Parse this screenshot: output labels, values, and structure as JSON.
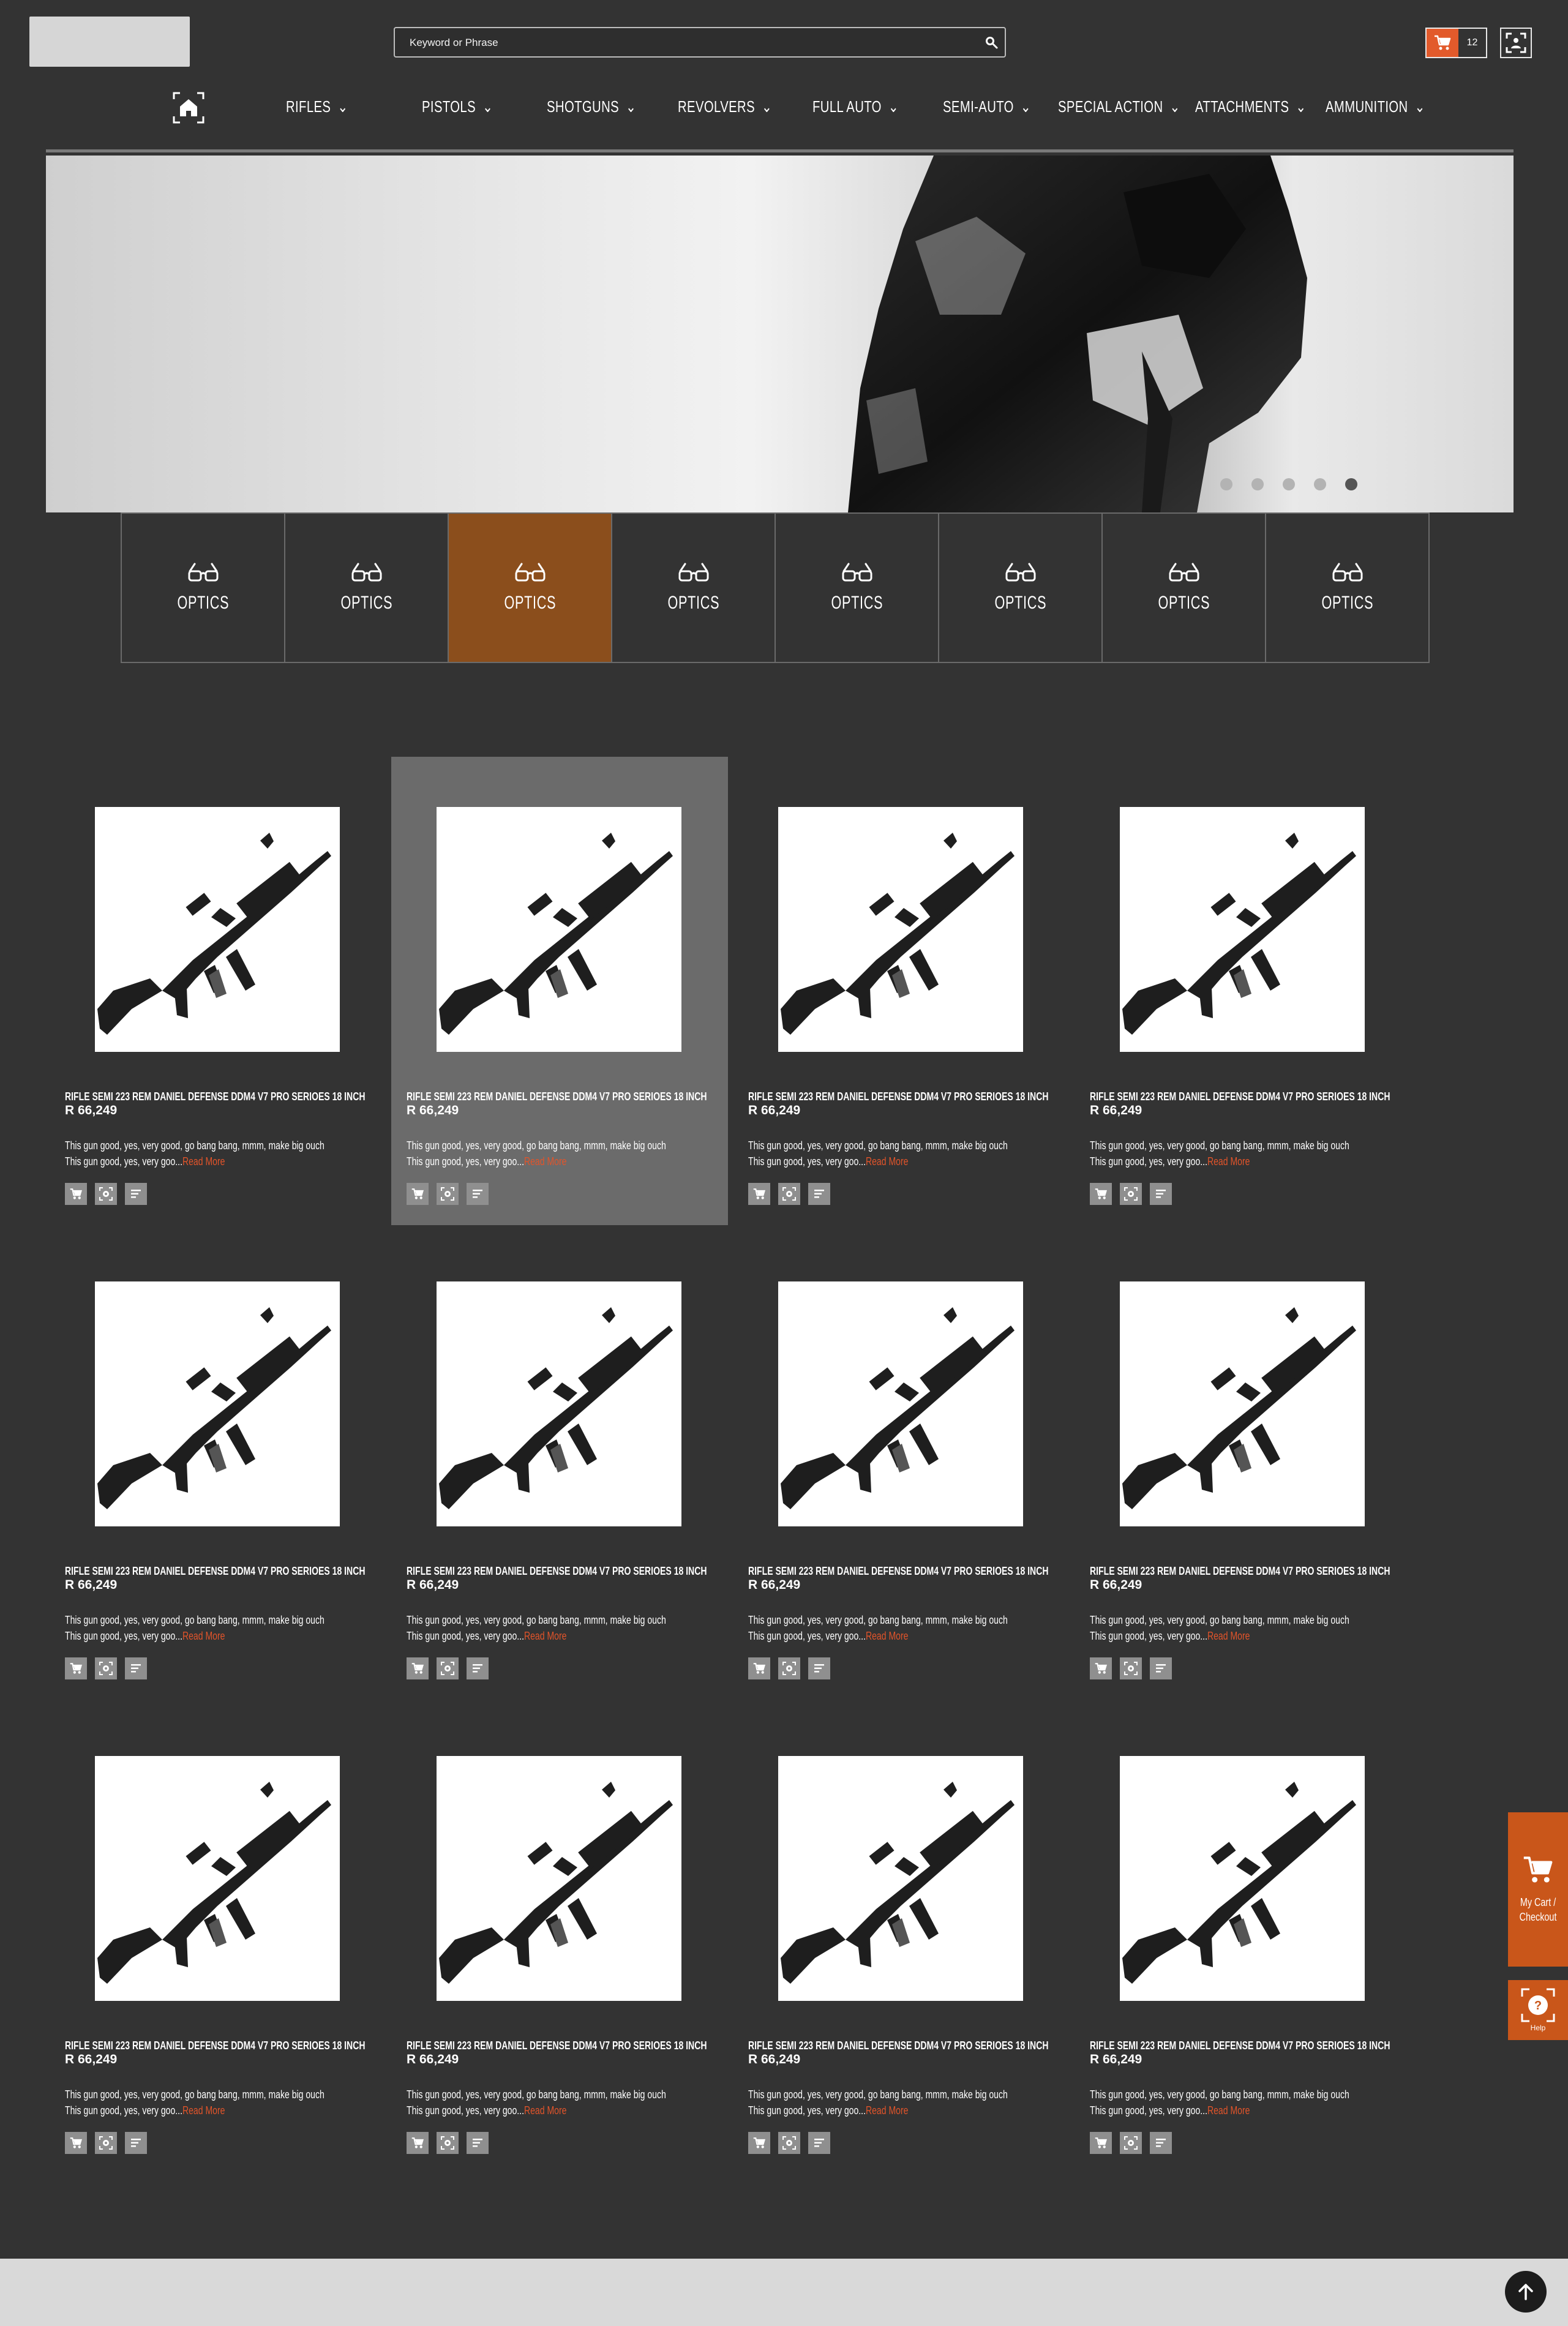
{
  "search": {
    "placeholder": "Keyword or Phrase"
  },
  "header": {
    "cart_count": "12"
  },
  "nav": {
    "items": [
      {
        "label": "RIFLES"
      },
      {
        "label": "PISTOLS"
      },
      {
        "label": "SHOTGUNS"
      },
      {
        "label": "REVOLVERS"
      },
      {
        "label": "FULL AUTO"
      },
      {
        "label": "SEMI-AUTO"
      },
      {
        "label": "SPECIAL ACTION"
      },
      {
        "label": "ATTACHMENTS"
      },
      {
        "label": "AMMUNITION"
      }
    ]
  },
  "slider": {
    "dot_count": 5,
    "active_dot": 5
  },
  "categories": [
    {
      "label": "OPTICS",
      "icon": "glasses-icon"
    },
    {
      "label": "OPTICS",
      "icon": "glasses-icon"
    },
    {
      "label": "OPTICS",
      "icon": "glasses-icon",
      "active": true
    },
    {
      "label": "OPTICS",
      "icon": "glasses-icon"
    },
    {
      "label": "OPTICS",
      "icon": "glasses-icon"
    },
    {
      "label": "OPTICS",
      "icon": "glasses-icon"
    },
    {
      "label": "OPTICS",
      "icon": "glasses-icon"
    },
    {
      "label": "OPTICS",
      "icon": "glasses-icon"
    }
  ],
  "products": [
    {
      "title": "RIFLE SEMI 223 REM DANIEL DEFENSE DDM4 V7 PRO SERIOES 18 INCH",
      "price": "R 66,249",
      "desc_line1": "This gun good, yes, very good, go bang bang, mmm, make big ouch",
      "desc_line2": "This gun good, yes, very goo...",
      "read_more": "Read More"
    },
    {
      "title": "RIFLE SEMI 223 REM DANIEL DEFENSE DDM4 V7 PRO SERIOES 18 INCH",
      "price": "R 66,249",
      "desc_line1": "This gun good, yes, very good, go bang bang, mmm, make big ouch",
      "desc_line2": "This gun good, yes, very goo...",
      "read_more": "Read More"
    },
    {
      "title": "RIFLE SEMI 223 REM DANIEL DEFENSE DDM4 V7 PRO SERIOES 18 INCH",
      "price": "R 66,249",
      "desc_line1": "This gun good, yes, very good, go bang bang, mmm, make big ouch",
      "desc_line2": "This gun good, yes, very goo...",
      "read_more": "Read More"
    },
    {
      "title": "RIFLE SEMI 223 REM DANIEL DEFENSE DDM4 V7 PRO SERIOES 18 INCH",
      "price": "R 66,249",
      "desc_line1": "This gun good, yes, very good, go bang bang, mmm, make big ouch",
      "desc_line2": "This gun good, yes, very goo...",
      "read_more": "Read More"
    },
    {
      "title": "RIFLE SEMI 223 REM DANIEL DEFENSE DDM4 V7 PRO SERIOES 18 INCH",
      "price": "R 66,249",
      "desc_line1": "This gun good, yes, very good, go bang bang, mmm, make big ouch",
      "desc_line2": "This gun good, yes, very goo...",
      "read_more": "Read More"
    },
    {
      "title": "RIFLE SEMI 223 REM DANIEL DEFENSE DDM4 V7 PRO SERIOES 18 INCH",
      "price": "R 66,249",
      "desc_line1": "This gun good, yes, very good, go bang bang, mmm, make big ouch",
      "desc_line2": "This gun good, yes, very goo...",
      "read_more": "Read More"
    },
    {
      "title": "RIFLE SEMI 223 REM DANIEL DEFENSE DDM4 V7 PRO SERIOES 18 INCH",
      "price": "R 66,249",
      "desc_line1": "This gun good, yes, very good, go bang bang, mmm, make big ouch",
      "desc_line2": "This gun good, yes, very goo...",
      "read_more": "Read More"
    },
    {
      "title": "RIFLE SEMI 223 REM DANIEL DEFENSE DDM4 V7 PRO SERIOES 18 INCH",
      "price": "R 66,249",
      "desc_line1": "This gun good, yes, very good, go bang bang, mmm, make big ouch",
      "desc_line2": "This gun good, yes, very goo...",
      "read_more": "Read More"
    },
    {
      "title": "RIFLE SEMI 223 REM DANIEL DEFENSE DDM4 V7 PRO SERIOES 18 INCH",
      "price": "R 66,249",
      "desc_line1": "This gun good, yes, very good, go bang bang, mmm, make big ouch",
      "desc_line2": "This gun good, yes, very goo...",
      "read_more": "Read More"
    },
    {
      "title": "RIFLE SEMI 223 REM DANIEL DEFENSE DDM4 V7 PRO SERIOES 18 INCH",
      "price": "R 66,249",
      "desc_line1": "This gun good, yes, very good, go bang bang, mmm, make big ouch",
      "desc_line2": "This gun good, yes, very goo...",
      "read_more": "Read More"
    },
    {
      "title": "RIFLE SEMI 223 REM DANIEL DEFENSE DDM4 V7 PRO SERIOES 18 INCH",
      "price": "R 66,249",
      "desc_line1": "This gun good, yes, very good, go bang bang, mmm, make big ouch",
      "desc_line2": "This gun good, yes, very goo...",
      "read_more": "Read More"
    },
    {
      "title": "RIFLE SEMI 223 REM DANIEL DEFENSE DDM4 V7 PRO SERIOES 18 INCH",
      "price": "R 66,249",
      "desc_line1": "This gun good, yes, very good, go bang bang, mmm, make big ouch",
      "desc_line2": "This gun good, yes, very goo...",
      "read_more": "Read More"
    }
  ],
  "side": {
    "cart_line1": "My Cart /",
    "cart_line2": "Checkout",
    "help_label": "Help"
  },
  "colors": {
    "accent": "#c9561a",
    "active_category": "#8b4e1c",
    "background": "#333333",
    "read_more": "#e2542a"
  }
}
